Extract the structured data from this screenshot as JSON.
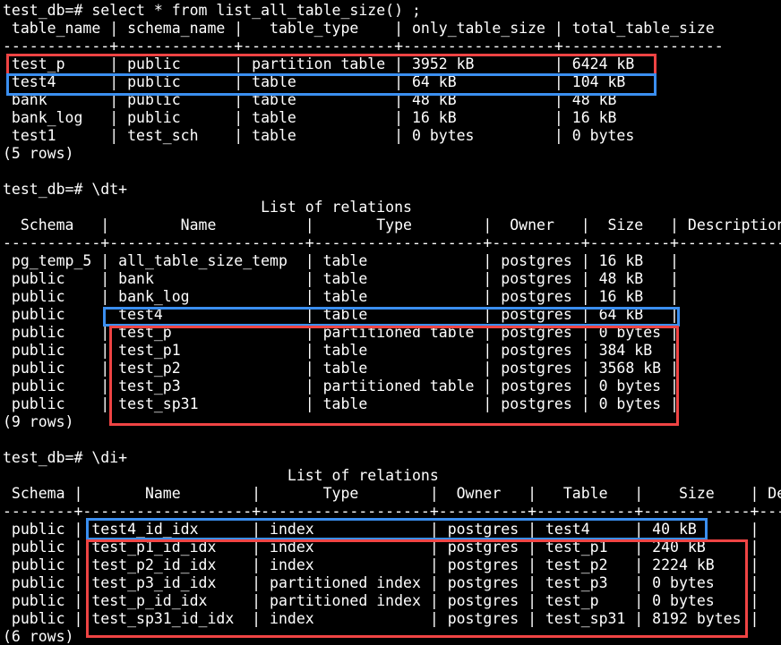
{
  "terminal": {
    "lines": [
      "test_db=# select * from list_all_table_size() ;",
      " table_name | schema_name |   table_type    | only_table_size | total_table_size",
      "------------+-------------+-----------------+-----------------+------------------",
      " test_p     | public      | partition table | 3952 kB         | 6424 kB",
      " test4      | public      | table           | 64 kB           | 104 kB",
      " bank       | public      | table           | 48 kB           | 48 kB",
      " bank_log   | public      | table           | 16 kB           | 16 kB",
      " test1      | test_sch    | table           | 0 bytes         | 0 bytes",
      "(5 rows)",
      "",
      "test_db=# \\dt+",
      "                             List of relations",
      "  Schema   |        Name          |       Type        |  Owner   |  Size   | Description",
      "-----------+----------------------+-------------------+----------+---------+-------------",
      " pg_temp_5 | all_table_size_temp  | table             | postgres | 16 kB   |",
      " public    | bank                 | table             | postgres | 48 kB   |",
      " public    | bank_log             | table             | postgres | 16 kB   |",
      " public    | test4                | table             | postgres | 64 kB   |",
      " public    | test_p               | partitioned table | postgres | 0 bytes |",
      " public    | test_p1              | table             | postgres | 384 kB  |",
      " public    | test_p2              | table             | postgres | 3568 kB |",
      " public    | test_p3              | partitioned table | postgres | 0 bytes |",
      " public    | test_sp31            | table             | postgres | 0 bytes |",
      "(9 rows)",
      "",
      "test_db=# \\di+",
      "                                List of relations",
      " Schema |       Name        |       Type        |  Owner   |   Table   |    Size    | De",
      "--------+-------------------+-------------------+----------+-----------+------------+---",
      " public | test4_id_idx      | index             | postgres | test4     | 40 kB      |",
      " public | test_p1_id_idx    | index             | postgres | test_p1   | 240 kB     |",
      " public | test_p2_id_idx    | index             | postgres | test_p2   | 2224 kB    |",
      " public | test_p3_id_idx    | partitioned index | postgres | test_p3   | 0 bytes    |",
      " public | test_p_id_idx     | partitioned index | postgres | test_p    | 0 bytes    |",
      " public | test_sp31_id_idx  | index             | postgres | test_sp31 | 8192 bytes |",
      "(6 rows)"
    ]
  },
  "highlight_colors": {
    "red": "#ef4444",
    "blue": "#3b8ff0"
  }
}
